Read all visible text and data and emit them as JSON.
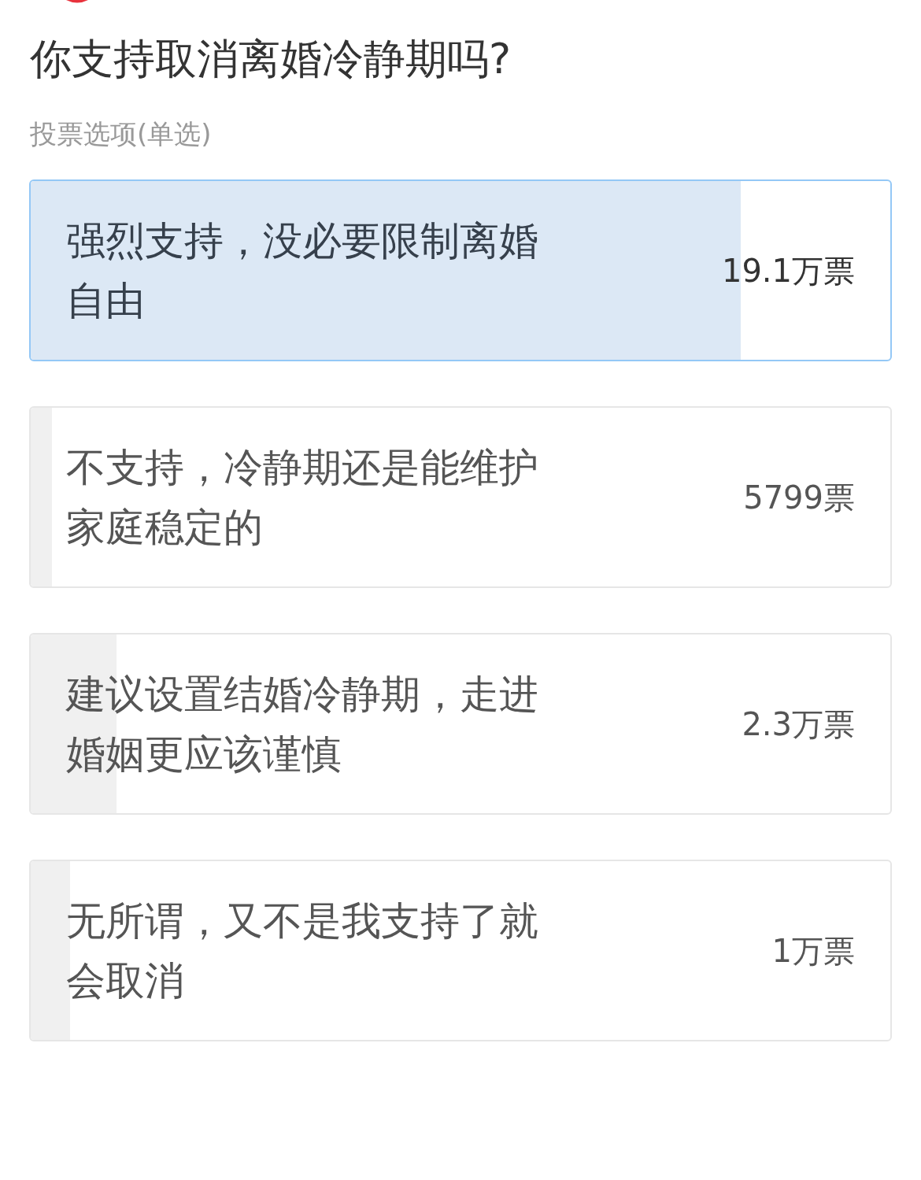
{
  "poll": {
    "title": "你支持取消离婚冷静期吗?",
    "subtitle": "投票选项(单选)"
  },
  "options": [
    {
      "label": "强烈支持，没必要限制离婚自由",
      "votes": "19.1万票",
      "level": 0.826,
      "selected": true
    },
    {
      "label": "不支持，冷静期还是能维护家庭稳定的",
      "votes": "5799票",
      "level": 0.025,
      "selected": false
    },
    {
      "label": "建议设置结婚冷静期，走进婚姻更应该谨慎",
      "votes": "2.3万票",
      "level": 0.1,
      "selected": false
    },
    {
      "label": "无所谓，又不是我支持了就会取消",
      "votes": "1万票",
      "level": 0.046,
      "selected": false
    }
  ]
}
